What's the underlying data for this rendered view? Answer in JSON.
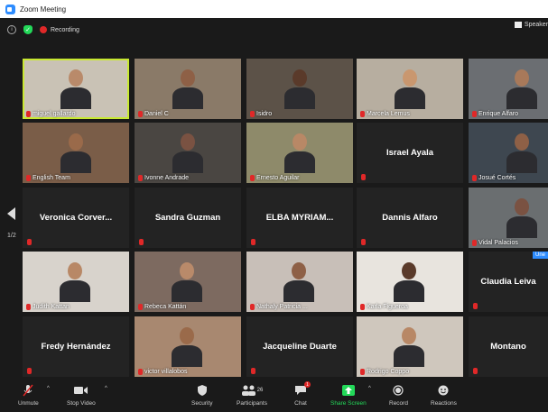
{
  "window": {
    "title": "Zoom Meeting"
  },
  "status": {
    "recording_label": "Recording",
    "view_label": "Speaker"
  },
  "pagination": {
    "page": "1/2"
  },
  "tiles": [
    {
      "name": "miguel gallardo",
      "video": true,
      "active": true
    },
    {
      "name": "Daniel C",
      "video": true
    },
    {
      "name": "Isidro",
      "video": true
    },
    {
      "name": "Marcela Lemus",
      "video": true
    },
    {
      "name": "Enrique Alfaro",
      "video": true
    },
    {
      "name": "English Team",
      "video": true
    },
    {
      "name": "Ivonne Andrade",
      "video": true
    },
    {
      "name": "Ernesto Aguilar",
      "video": true
    },
    {
      "name": "Israel Ayala",
      "video": false
    },
    {
      "name": "Josué Cortés",
      "video": true
    },
    {
      "name": "Veronica Corver...",
      "video": false
    },
    {
      "name": "Sandra Guzman",
      "video": false
    },
    {
      "name": "ELBA MYRIAM...",
      "video": false
    },
    {
      "name": "Dannis Alfaro",
      "video": false
    },
    {
      "name": "Vidal Palacios",
      "video": true
    },
    {
      "name": "Judith Kattan",
      "video": true
    },
    {
      "name": "Rebeca Kattán",
      "video": true
    },
    {
      "name": "Nathaly Patricia ...",
      "video": true
    },
    {
      "name": "Karla Figueroa",
      "video": true
    },
    {
      "name": "Claudia Leiva",
      "video": false,
      "badge": "Une"
    },
    {
      "name": "Fredy Hernández",
      "video": false
    },
    {
      "name": "victor villalobos",
      "video": true
    },
    {
      "name": "Jacqueline Duarte",
      "video": false
    },
    {
      "name": "Rodrigo Coppo",
      "video": true
    },
    {
      "name": "Montano",
      "video": false
    }
  ],
  "toolbar": {
    "unmute": "Unmute",
    "stop_video": "Stop Video",
    "security": "Security",
    "participants": "Participants",
    "participants_count": "26",
    "chat": "Chat",
    "chat_badge": "1",
    "share_screen": "Share Screen",
    "record": "Record",
    "reactions": "Reactions"
  },
  "colors": {
    "active_speaker": "#c8e832",
    "recording": "#e02828",
    "share_green": "#23d959",
    "accent": "#2d8cff"
  }
}
